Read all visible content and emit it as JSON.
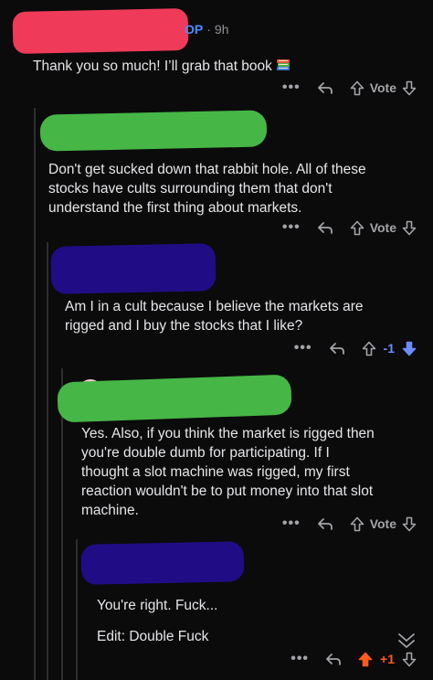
{
  "comments": [
    {
      "meta": {
        "op_label": "OP",
        "separator": "·",
        "time": "9h"
      },
      "text": "Thank you so much! I’ll grab that book",
      "vote_label": "Vote"
    },
    {
      "text": "Don't get sucked down that rabbit hole. All of these\nstocks have cults surrounding them that don't\nunderstand the first thing about markets.",
      "vote_label": "Vote"
    },
    {
      "text": "Am I in a cult because I believe the markets are\nrigged and I buy the stocks that I like?",
      "vote_count": "-1"
    },
    {
      "text": "Yes. Also, if you think the market is rigged then\nyou're double dumb for participating. If I\nthought a slot machine was rigged, my first\nreaction wouldn't be to put money into that slot\nmachine.",
      "vote_label": "Vote"
    },
    {
      "text_line1": "You're right. Fuck...",
      "text_line2": "Edit: Double Fuck",
      "vote_count": "+1"
    }
  ],
  "icons": {
    "more": "more-dots-icon",
    "reply": "reply-icon",
    "upvote": "upvote-arrow-icon",
    "downvote": "downvote-arrow-icon",
    "collapse": "collapse-chevrons-icon",
    "book": "books-emoji-icon"
  },
  "colors": {
    "background": "#0b0b0c",
    "upvoted": "#ff5a1f",
    "downvoted": "#6b8cff",
    "op_badge": "#4b8bff"
  }
}
